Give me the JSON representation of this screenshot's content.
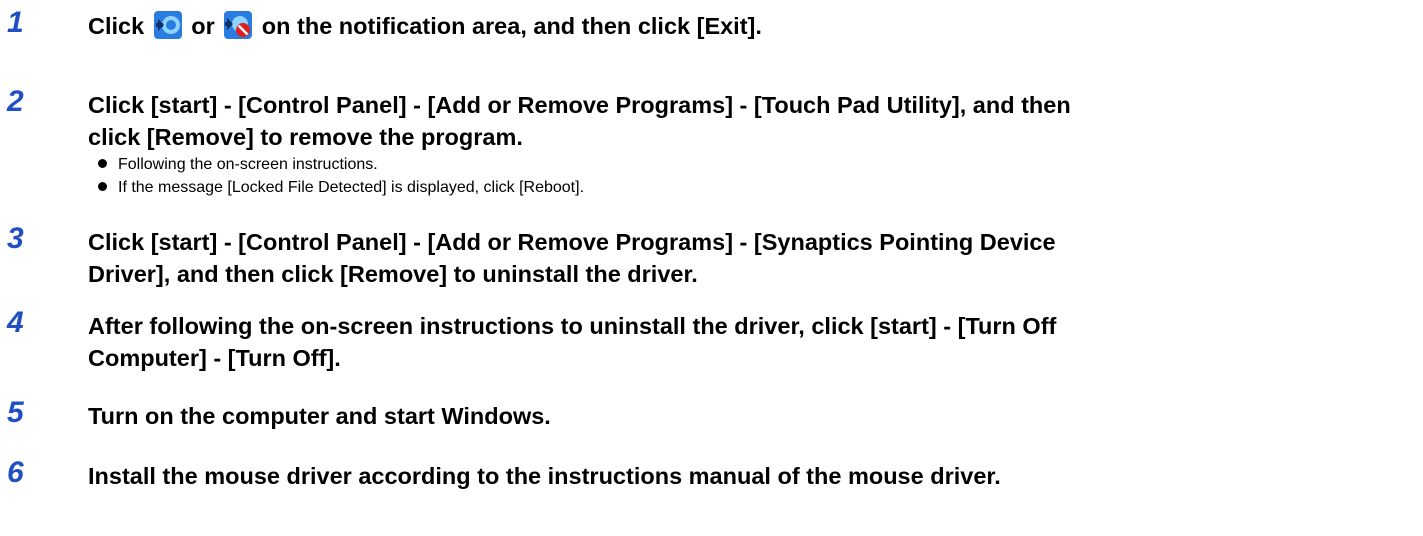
{
  "steps": [
    {
      "num": "1",
      "parts": [
        "Click ",
        " or ",
        " on the notification area, and then click [Exit]."
      ],
      "icons": [
        "touch-pad-utility-icon",
        "touch-pad-utility-disabled-icon"
      ]
    },
    {
      "num": "2",
      "lines": [
        "Click [start] - [Control Panel] - [Add or Remove Programs] - [Touch Pad Utility], and then",
        "click [Remove] to remove the program."
      ],
      "bullets": [
        "Following the on-screen instructions.",
        "If the message [Locked File Detected] is displayed, click [Reboot]."
      ]
    },
    {
      "num": "3",
      "lines": [
        "Click [start] - [Control Panel] - [Add or Remove Programs] - [Synaptics Pointing Device",
        "Driver], and then click [Remove] to uninstall the driver."
      ]
    },
    {
      "num": "4",
      "lines": [
        "After following the on-screen instructions to uninstall the driver, click [start] - [Turn Off",
        "Computer] - [Turn Off]."
      ]
    },
    {
      "num": "5",
      "lines": [
        "Turn on the computer and start Windows."
      ]
    },
    {
      "num": "6",
      "lines": [
        "Install the mouse driver according to the instructions manual of the mouse driver."
      ]
    }
  ],
  "colors": {
    "step_number": "#1f4fc0",
    "text": "#000000"
  }
}
